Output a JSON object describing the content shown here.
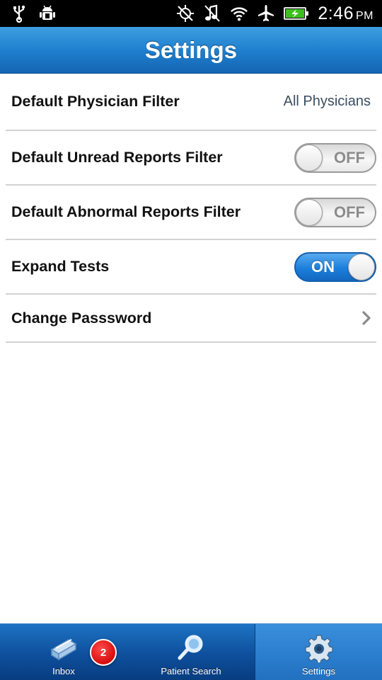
{
  "status_bar": {
    "icons": [
      "usb-icon",
      "android-debug-icon",
      "gps-off-icon",
      "music-muted-icon",
      "wifi-icon",
      "airplane-icon",
      "battery-charging-icon"
    ],
    "time": "2:46",
    "ampm": "PM"
  },
  "header": {
    "title": "Settings"
  },
  "settings": {
    "physician_filter": {
      "label": "Default Physician Filter",
      "value": "All Physicians"
    },
    "unread_filter": {
      "label": "Default Unread Reports Filter",
      "state": "OFF"
    },
    "abnormal_filter": {
      "label": "Default Abnormal Reports Filter",
      "state": "OFF"
    },
    "expand_tests": {
      "label": "Expand Tests",
      "state": "ON"
    },
    "change_password": {
      "label": "Change Passsword"
    }
  },
  "tabs": [
    {
      "label": "Inbox",
      "icon": "inbox-icon",
      "badge": "2"
    },
    {
      "label": "Patient Search",
      "icon": "magnifier-icon"
    },
    {
      "label": "Settings",
      "icon": "gear-icon",
      "active": true
    }
  ],
  "colors": {
    "accent": "#1f80cf",
    "toggle_on": "#1b7fdb",
    "badge": "#d60d0d"
  }
}
